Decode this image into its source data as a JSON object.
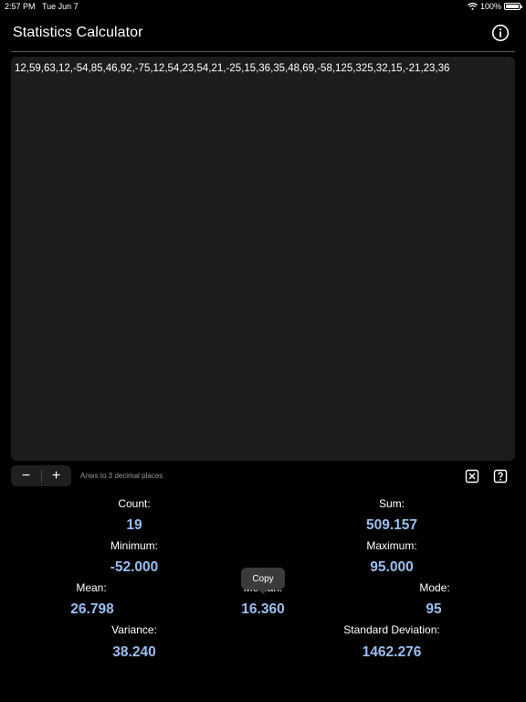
{
  "status_bar": {
    "time": "2:57 PM",
    "date": "Tue Jun 7",
    "battery": "100%",
    "battery_level": 1.0,
    "wifi_icon": "wifi-icon"
  },
  "header": {
    "title": "Statistics Calculator",
    "info_icon": "info-icon"
  },
  "input": {
    "value": "12,59,63,12,-54,85,46,92,-75,12,54,23,54,21,-25,15,36,35,48,69,-58,125,325,32,15,-21,23,36"
  },
  "controls": {
    "minus_label": "−",
    "plus_label": "+",
    "decimal_note": "Anws to 3 decimal places",
    "clear_icon": "clear-x-icon",
    "help_icon": "question-icon"
  },
  "stats": {
    "count_label": "Count:",
    "count_value": "19",
    "sum_label": "Sum:",
    "sum_value": "509.157",
    "minimum_label": "Minimum:",
    "minimum_value": "-52.000",
    "maximum_label": "Maximum:",
    "maximum_value": "95.000",
    "mean_label": "Mean:",
    "mean_value": "26.798",
    "median_label": "Median:",
    "median_value": "16.360",
    "mode_label": "Mode:",
    "mode_value": "95",
    "variance_label": "Variance:",
    "variance_value": "38.240",
    "std_label": "Standard Deviation:",
    "std_value": "1462.276"
  },
  "tooltip": {
    "label": "Copy"
  },
  "colors": {
    "background": "#000000",
    "panel": "#1c1c1e",
    "value_accent": "#9bbdf0",
    "tooltip": "#3a3a3c"
  }
}
